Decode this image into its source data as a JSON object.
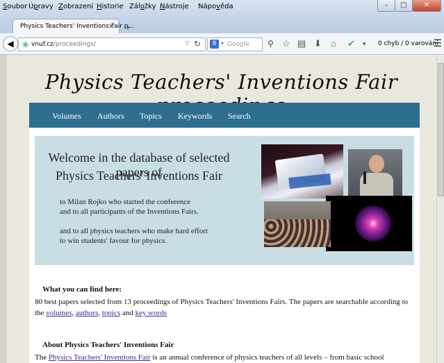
{
  "browser": {
    "menu": [
      {
        "pre": "",
        "u": "S",
        "post": "oubor"
      },
      {
        "pre": "Ú",
        "u": "p",
        "post": "ravy"
      },
      {
        "pre": "",
        "u": "Z",
        "post": "obrazení"
      },
      {
        "pre": "",
        "u": "H",
        "post": "istorie"
      },
      {
        "pre": "Zál",
        "u": "o",
        "post": "žky"
      },
      {
        "pre": "",
        "u": "N",
        "post": "ástroje"
      },
      {
        "pre": "Nápo",
        "u": "v",
        "post": "ěda"
      }
    ],
    "tab_title": "Physics Teachers' Inventions Fair p...",
    "url_host": "vnuf.cz",
    "url_path": "/proceedings/",
    "search_placeholder": "Google",
    "validator_text": "0 chyb / 0 varování"
  },
  "page": {
    "site_title": "Physics Teachers' Inventions Fair proceedings",
    "nav": [
      "Volumes",
      "Authors",
      "Topics",
      "Keywords",
      "Search"
    ],
    "hero": {
      "welcome_line1": "Welcome in the database of selected papers of",
      "welcome_line2": "Physics Teachers' Inventions Fair",
      "dedication": [
        "to Milan Rojko who started the conference",
        "and to all participants of the Inventions Fairs.",
        "and to all physics teachers who make hard effort",
        "to win students' favour for physics."
      ]
    },
    "what_heading": "What you can find here:",
    "what_text_1": "80 best papers selected from 13 proceedings of Physics Teachers' Inventions Fairs. The papers are searchable according to the ",
    "what_links": [
      "volumes",
      "authors",
      "topics",
      "key words"
    ],
    "about_heading": "About Physics Teachers' Inventions Fair",
    "about_pre": "The ",
    "about_link": "Physics Teachers' Inventions Fair",
    "about_post": " is an annual conference of physics teachers of all levels – from basic school"
  }
}
